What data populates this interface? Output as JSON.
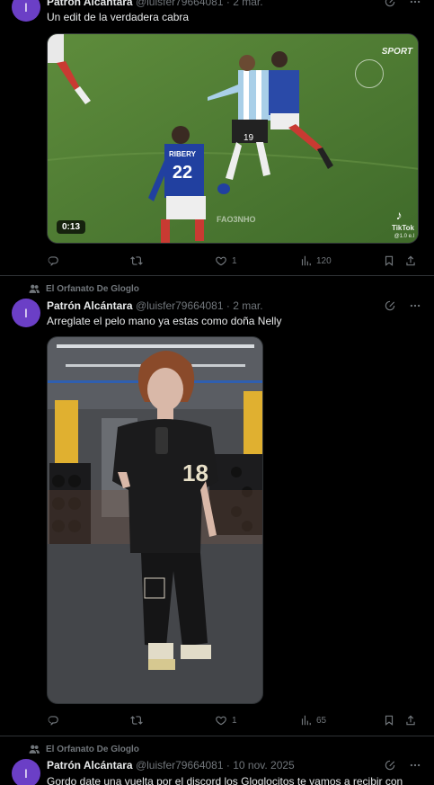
{
  "posts": [
    {
      "author": "Patrón Alcántara",
      "handle": "@luisfer79664081",
      "time": "2 mar.",
      "text": "Un edit de la verdadera cabra",
      "avatar_letter": "I",
      "media": {
        "duration": "0:13",
        "watermark_top": "SPORT",
        "watermark_center": "FAO3NHO",
        "tiktok_label": "TikTok",
        "tiktok_sub": "@1.0 e.l",
        "player_number": "22",
        "player_name": "RIBERY",
        "messi_number": "19"
      },
      "stats": {
        "replies": "",
        "reposts": "",
        "likes": "1",
        "views": "120"
      }
    },
    {
      "social_context": "El Orfanato De Gloglo",
      "author": "Patrón Alcántara",
      "handle": "@luisfer79664081",
      "time": "2 mar.",
      "text": "Arreglate el pelo mano ya estas como doña Nelly",
      "avatar_letter": "I",
      "media": {
        "shirt_number": "18"
      },
      "stats": {
        "replies": "",
        "reposts": "",
        "likes": "1",
        "views": "65"
      }
    },
    {
      "social_context": "El Orfanato De Gloglo",
      "author": "Patrón Alcántara",
      "handle": "@luisfer79664081",
      "time": "10 nov. 2025",
      "text": "Gordo date una vuelta por el discord los Gloglocitos te vamos a recibir con",
      "avatar_letter": "I"
    }
  ],
  "colors": {
    "background": "#000000",
    "border": "#2f3336",
    "text_primary": "#e7e9ea",
    "text_secondary": "#71767b",
    "avatar": "#6b3fc6"
  }
}
